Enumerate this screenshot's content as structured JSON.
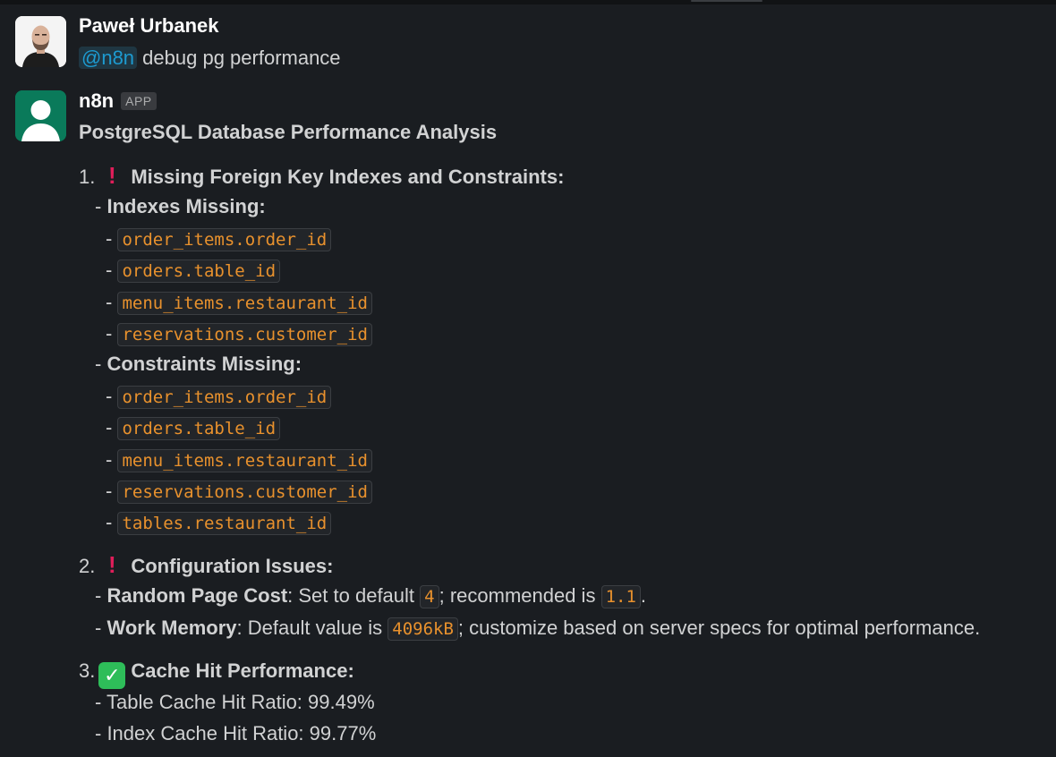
{
  "messages": {
    "user": {
      "author": "Paweł Urbanek",
      "mention": "@n8n",
      "text": "debug pg performance"
    },
    "bot": {
      "author": "n8n",
      "badge": "APP",
      "title": "PostgreSQL Database Performance Analysis",
      "section1": {
        "num": "1.",
        "icon": "exclamation-icon",
        "heading": "Missing Foreign Key Indexes and Constraints:",
        "indexes_label": "Indexes Missing:",
        "indexes": [
          "order_items.order_id",
          "orders.table_id",
          "menu_items.restaurant_id",
          "reservations.customer_id"
        ],
        "constraints_label": "Constraints Missing:",
        "constraints": [
          "order_items.order_id",
          "orders.table_id",
          "menu_items.restaurant_id",
          "reservations.customer_id",
          "tables.restaurant_id"
        ]
      },
      "section2": {
        "num": "2.",
        "icon": "exclamation-icon",
        "heading": "Configuration Issues:",
        "rpc_label": "Random Page Cost",
        "rpc_text1": ": Set to default ",
        "rpc_default": "4",
        "rpc_text2": "; recommended is ",
        "rpc_rec": "1.1",
        "rpc_text3": ".",
        "wm_label": "Work Memory",
        "wm_text1": ": Default value is ",
        "wm_value": "4096kB",
        "wm_text2": "; customize based on server specs for optimal performance."
      },
      "section3": {
        "num": "3.",
        "icon": "check-mark-icon",
        "heading": "Cache Hit Performance:",
        "table_ratio": "- Table Cache Hit Ratio: 99.49%",
        "index_ratio": "- Index Cache Hit Ratio: 99.77%"
      }
    }
  },
  "colors": {
    "background": "#1a1d21",
    "code_text": "#e8912d",
    "mention": "#1d9bd1",
    "bot_avatar": "#0a7a5a",
    "alert": "#e01e5a",
    "success": "#2ebd59"
  }
}
